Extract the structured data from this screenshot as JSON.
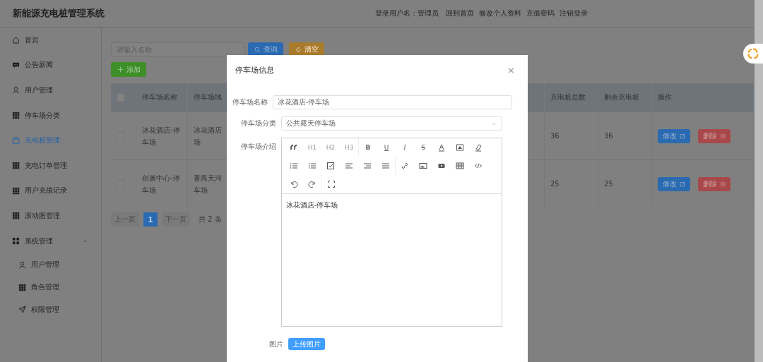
{
  "header": {
    "title": "新能源充电桩管理系统",
    "links": [
      "登录用户名：管理员",
      "回到首页",
      "修改个人资料",
      "充值密码",
      "注销登录"
    ]
  },
  "sidebar": {
    "items": [
      {
        "label": "首页",
        "selected": false
      },
      {
        "label": "公告新闻",
        "selected": false
      },
      {
        "label": "用户管理",
        "selected": false
      },
      {
        "label": "停车场分类",
        "selected": false
      },
      {
        "label": "充电桩管理",
        "selected": true
      },
      {
        "label": "充电订单管理",
        "selected": false
      },
      {
        "label": "用户充值记录",
        "selected": false
      },
      {
        "label": "滚动图管理",
        "selected": false
      },
      {
        "label": "系统管理",
        "selected": false,
        "expanded": true,
        "children": [
          {
            "label": "用户管理",
            "selected": false
          },
          {
            "label": "角色管理",
            "selected": false
          },
          {
            "label": "权限管理",
            "selected": false
          }
        ]
      }
    ]
  },
  "search": {
    "placeholder": "请输入名称",
    "buttons": [
      "查询",
      "清空"
    ],
    "add_button": "添加"
  },
  "table": {
    "all_checked": false,
    "columns": [
      "停车场名称",
      "停车场地",
      "充电桩总数",
      "剩余充电桩",
      "操作"
    ],
    "rows": [
      {
        "checked": false,
        "name": "冰花酒店-停车场",
        "address": [
          "冰花酒店",
          "场"
        ],
        "total": "36",
        "remaining": "36",
        "actions": [
          "修改",
          "删除"
        ]
      },
      {
        "checked": false,
        "name": "创展中心-停车场",
        "address": [
          "番禺天河",
          "车场"
        ],
        "total": "25",
        "remaining": "25",
        "actions": [
          "修改",
          "删除"
        ]
      }
    ]
  },
  "pagination": {
    "prev": {
      "label": "上一页",
      "disabled": true
    },
    "pages": [
      {
        "label": "1",
        "selected": true
      }
    ],
    "next": {
      "label": "下一页",
      "disabled": true
    },
    "total": "共 2 条"
  },
  "dialog": {
    "title": "停车场信息",
    "close": "×",
    "fields": [
      {
        "label": "停车场名称",
        "kind": "input",
        "value": "冰花酒店-停车场"
      },
      {
        "label": "停车场分类",
        "kind": "select",
        "value": "公共露天停车场"
      }
    ],
    "editor": {
      "label": "停车场介绍",
      "toolbar_labels": [
        "H1",
        "H2",
        "H3",
        "B",
        "U",
        "I",
        "S"
      ],
      "content": "冰花酒店-停车场"
    },
    "image": {
      "label": "图片",
      "button": "上传图片"
    }
  }
}
